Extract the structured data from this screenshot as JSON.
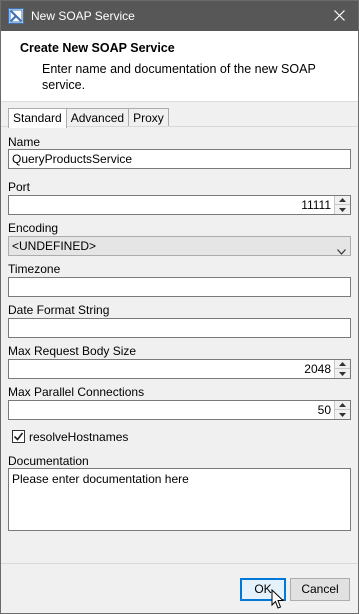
{
  "window": {
    "title": "New SOAP Service",
    "close_icon": "close-icon"
  },
  "header": {
    "title": "Create New SOAP Service",
    "description": "Enter name and documentation of the new SOAP service."
  },
  "tabs": [
    {
      "label": "Standard",
      "active": true
    },
    {
      "label": "Advanced",
      "active": false
    },
    {
      "label": "Proxy",
      "active": false
    }
  ],
  "form": {
    "name_label": "Name",
    "name_value": "QueryProductsService",
    "port_label": "Port",
    "port_value": "11111",
    "encoding_label": "Encoding",
    "encoding_value": "<UNDEFINED>",
    "timezone_label": "Timezone",
    "timezone_value": "",
    "date_format_label": "Date Format String",
    "date_format_value": "",
    "max_body_label": "Max Request Body Size",
    "max_body_value": "2048",
    "max_conn_label": "Max Parallel Connections",
    "max_conn_value": "50",
    "resolve_label": "resolveHostnames",
    "resolve_checked": true,
    "doc_label": "Documentation",
    "doc_value": "Please enter documentation here"
  },
  "buttons": {
    "ok": "OK",
    "cancel": "Cancel"
  }
}
